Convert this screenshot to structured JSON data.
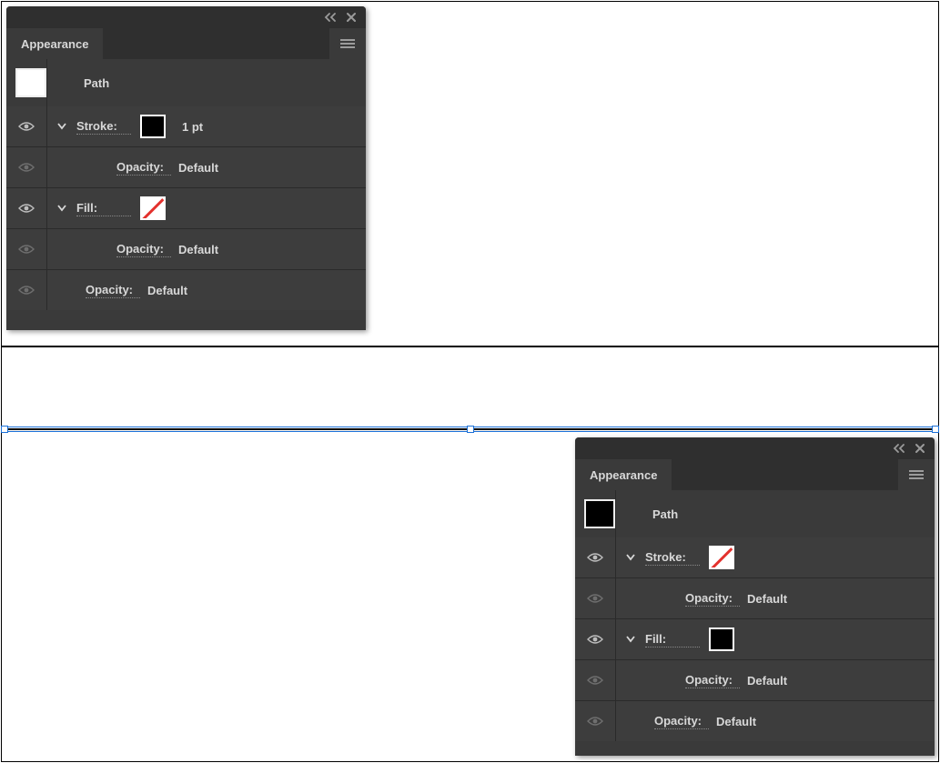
{
  "panelA": {
    "title": "Appearance",
    "object": "Path",
    "thumbSwatch": "white",
    "rows": [
      {
        "type": "attr",
        "label": "Stroke:",
        "swatch": "black",
        "value": "1 pt",
        "eye": "on",
        "expand": true
      },
      {
        "type": "opacity",
        "label": "Opacity:",
        "value": "Default",
        "eye": "dim"
      },
      {
        "type": "attr",
        "label": "Fill:",
        "swatch": "none",
        "value": "",
        "eye": "on",
        "expand": true
      },
      {
        "type": "opacity",
        "label": "Opacity:",
        "value": "Default",
        "eye": "dim"
      },
      {
        "type": "objopacity",
        "label": "Opacity:",
        "value": "Default",
        "eye": "dim"
      }
    ]
  },
  "panelB": {
    "title": "Appearance",
    "object": "Path",
    "thumbSwatch": "black",
    "rows": [
      {
        "type": "attr",
        "label": "Stroke:",
        "swatch": "none",
        "value": "",
        "eye": "on",
        "expand": true
      },
      {
        "type": "opacity",
        "label": "Opacity:",
        "value": "Default",
        "eye": "dim"
      },
      {
        "type": "attr",
        "label": "Fill:",
        "swatch": "black",
        "value": "",
        "eye": "on",
        "expand": true
      },
      {
        "type": "opacity",
        "label": "Opacity:",
        "value": "Default",
        "eye": "dim"
      },
      {
        "type": "objopacity",
        "label": "Opacity:",
        "value": "Default",
        "eye": "dim"
      }
    ]
  }
}
